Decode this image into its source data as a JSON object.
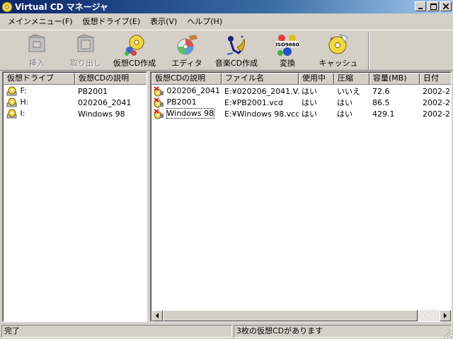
{
  "window": {
    "title": "Virtual CD マネージャ"
  },
  "menu": [
    "メインメニュー(F)",
    "仮想ドライブ(E)",
    "表示(V)",
    "ヘルプ(H)"
  ],
  "toolbar": {
    "insert": "挿入",
    "eject": "取り出し",
    "create_vcd": "仮想CD作成",
    "editor": "エディタ",
    "music_cd": "音楽CD作成",
    "convert": "変換",
    "cache": "キャッシュ",
    "convert_badge": "ISO9660"
  },
  "drives": {
    "columns": [
      "仮想ドライブ",
      "仮想CDの説明"
    ],
    "rows": [
      {
        "drive": "F:",
        "desc": "PB2001"
      },
      {
        "drive": "H:",
        "desc": "020206_2041"
      },
      {
        "drive": "I:",
        "desc": "Windows 98"
      }
    ]
  },
  "vcds": {
    "columns": [
      "仮想CDの説明",
      "ファイル名",
      "使用中",
      "圧縮",
      "容量(MB)",
      "日付"
    ],
    "rows": [
      {
        "desc": "020206_2041",
        "file": "E:¥020206_2041.V...",
        "in_use": "はい",
        "compressed": "いいえ",
        "size": "72.6",
        "date": "2002-2-"
      },
      {
        "desc": "PB2001",
        "file": "E:¥PB2001.vcd",
        "in_use": "はい",
        "compressed": "はい",
        "size": "86.5",
        "date": "2002-2-"
      },
      {
        "desc": "Windows 98",
        "file": "E:¥Windows 98.vcd",
        "in_use": "はい",
        "compressed": "はい",
        "size": "429.1",
        "date": "2002-2-"
      }
    ]
  },
  "status": {
    "left": "完了",
    "right": "3枚の仮想CDがあります"
  }
}
